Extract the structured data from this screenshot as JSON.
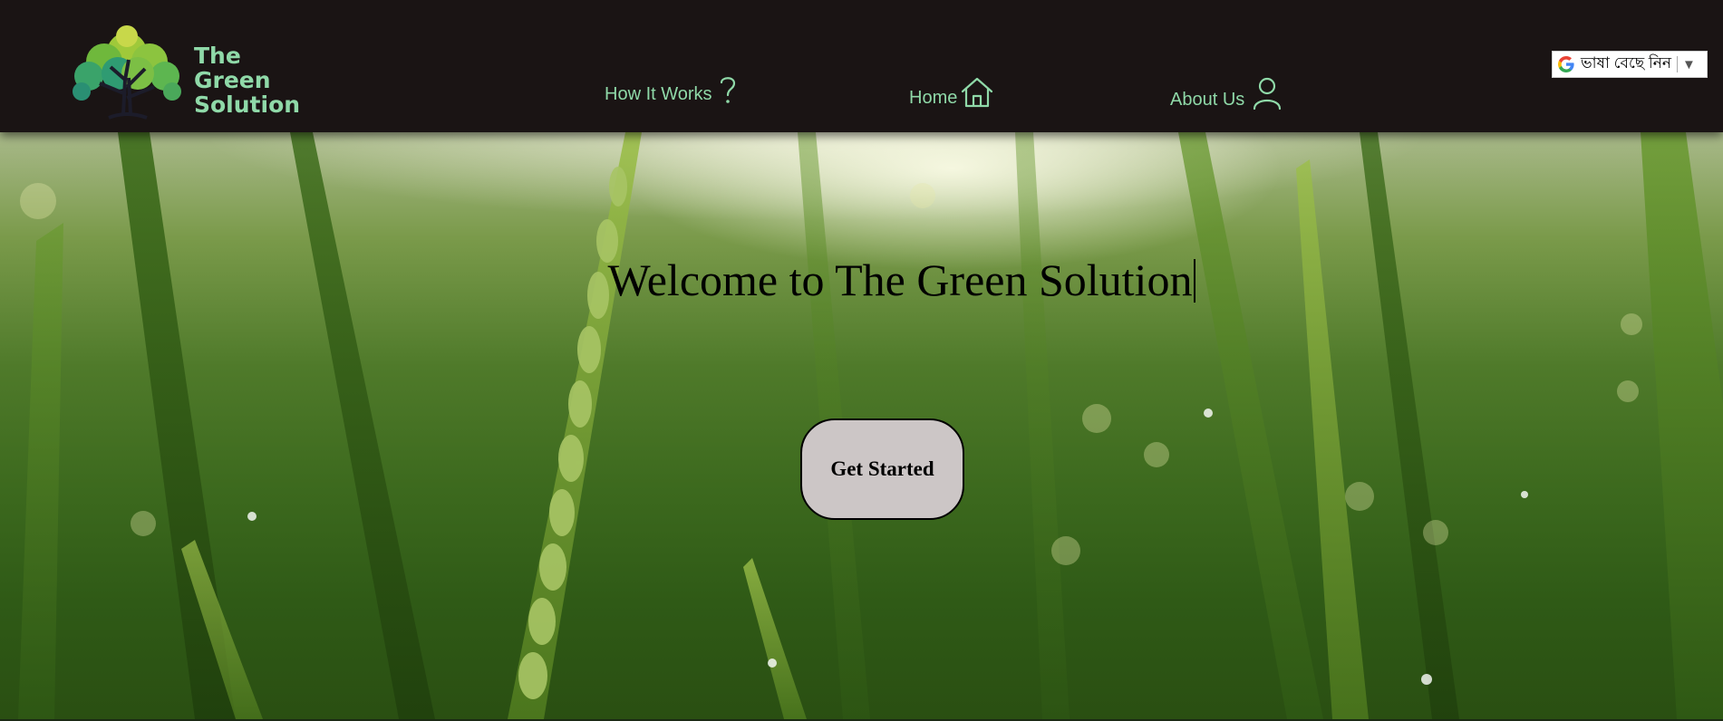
{
  "brand": {
    "name_line1": "The",
    "name_line2": "Green",
    "name_line3": "Solution"
  },
  "nav": {
    "items": [
      {
        "label": "How It Works",
        "icon": "question-icon"
      },
      {
        "label": "Home",
        "icon": "home-icon"
      },
      {
        "label": "About Us",
        "icon": "user-icon"
      }
    ]
  },
  "language_selector": {
    "label": "ভাষা বেছে নিন",
    "icon": "google-icon",
    "arrow": "▼"
  },
  "hero": {
    "headline": "Welcome to The Green Solution",
    "cta_label": "Get Started"
  },
  "colors": {
    "header_bg": "#1a1414",
    "nav_text": "#8fd9a8",
    "cta_bg": "#ccc6c6"
  }
}
